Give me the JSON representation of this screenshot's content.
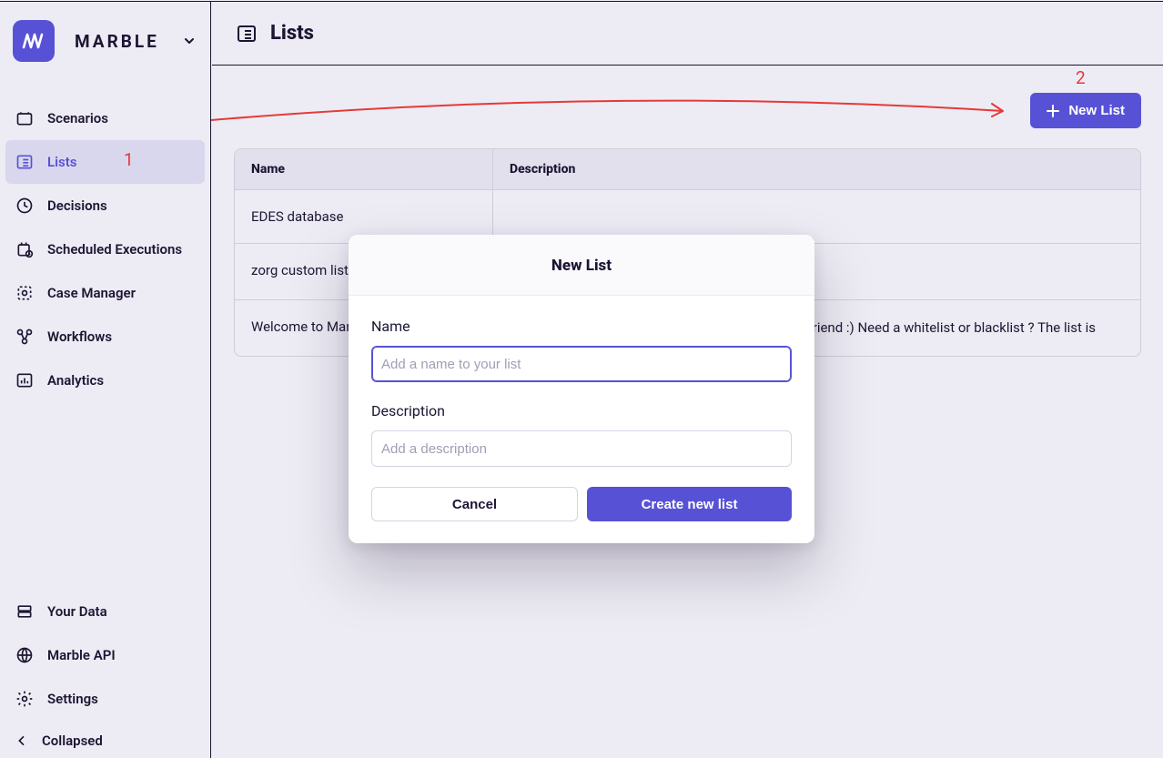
{
  "brand": {
    "name": "MARBLE"
  },
  "sidebar": {
    "items": [
      {
        "label": "Scenarios"
      },
      {
        "label": "Lists"
      },
      {
        "label": "Decisions"
      },
      {
        "label": "Scheduled Executions"
      },
      {
        "label": "Case Manager"
      },
      {
        "label": "Workflows"
      },
      {
        "label": "Analytics"
      }
    ],
    "bottom": [
      {
        "label": "Your Data"
      },
      {
        "label": "Marble API"
      },
      {
        "label": "Settings"
      }
    ],
    "collapsed_label": "Collapsed"
  },
  "page": {
    "title": "Lists"
  },
  "toolbar": {
    "new_list_label": "New List"
  },
  "table": {
    "headers": {
      "name": "Name",
      "description": "Description"
    },
    "rows": [
      {
        "name": "EDES database",
        "description": ""
      },
      {
        "name": "zorg custom list",
        "description": ":)"
      },
      {
        "name": "Welcome to Mar",
        "description": ":) Need a whitelist or blacklist ? The list is your ur friend :) Need a whitelist or blacklist ? The list is"
      }
    ]
  },
  "annotations": {
    "one": "1",
    "two": "2"
  },
  "modal": {
    "title": "New List",
    "name_label": "Name",
    "name_placeholder": "Add a name to your list",
    "description_label": "Description",
    "description_placeholder": "Add a description",
    "cancel_label": "Cancel",
    "create_label": "Create new list"
  },
  "colors": {
    "accent": "#5752d5"
  }
}
